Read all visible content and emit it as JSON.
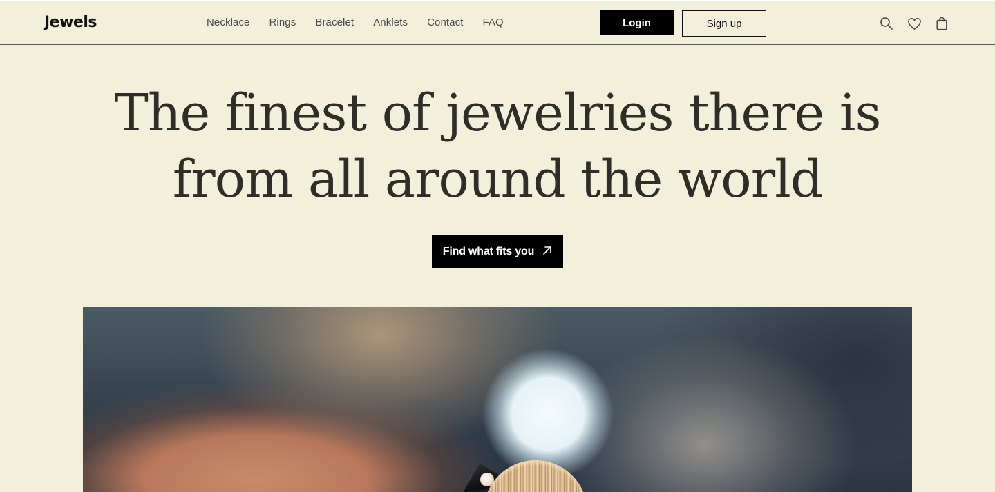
{
  "header": {
    "brand": "Jewels",
    "menu": [
      "Necklace",
      "Rings",
      "Bracelet",
      "Anklets",
      "Contact",
      "FAQ"
    ],
    "login_label": "Login",
    "signup_label": "Sign up",
    "icons": [
      "search-icon",
      "heart-icon",
      "shopping-bag-icon"
    ]
  },
  "hero": {
    "title_line1": "The finest of jewelries there is",
    "title_line2": "from all around the world",
    "cta_label": "Find what fits you",
    "cta_icon": "arrow-up-right-icon"
  },
  "colors": {
    "background": "#f2efda",
    "text": "#2e2d28",
    "button": "#000000"
  }
}
